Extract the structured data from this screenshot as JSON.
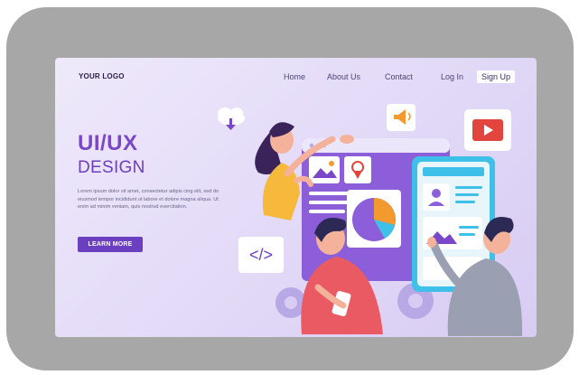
{
  "header": {
    "logo_text": "YOUR LOGO",
    "nav": [
      {
        "label": "Home"
      },
      {
        "label": "About Us"
      },
      {
        "label": "Contact"
      },
      {
        "label": "Log In"
      }
    ],
    "signup_label": "Sign Up"
  },
  "hero": {
    "title": "UI/UX",
    "subtitle": "DESIGN",
    "body": "Lorem ipsum dolor sit amet, consectetur adipis cing elit, sed do eiusmod tempor incididunt ut labore et dolore magna aliqua. Ut enim ad minim veniam, quis nostrud exercitation.",
    "cta_label": "LEARN MORE"
  },
  "illustration": {
    "code_tag": "</>",
    "icons": [
      "cloud-download-icon",
      "megaphone-icon",
      "play-video-icon",
      "image-icon",
      "location-pin-icon",
      "pie-chart-icon",
      "user-profile-icon",
      "gear-icon"
    ]
  },
  "colors": {
    "accent": "#7b47c9",
    "button": "#6a3fc0",
    "frame": "#a7a7a7",
    "page_bg": "#e6dff8",
    "video_red": "#e2453d",
    "chart_orange": "#f29a2e"
  }
}
